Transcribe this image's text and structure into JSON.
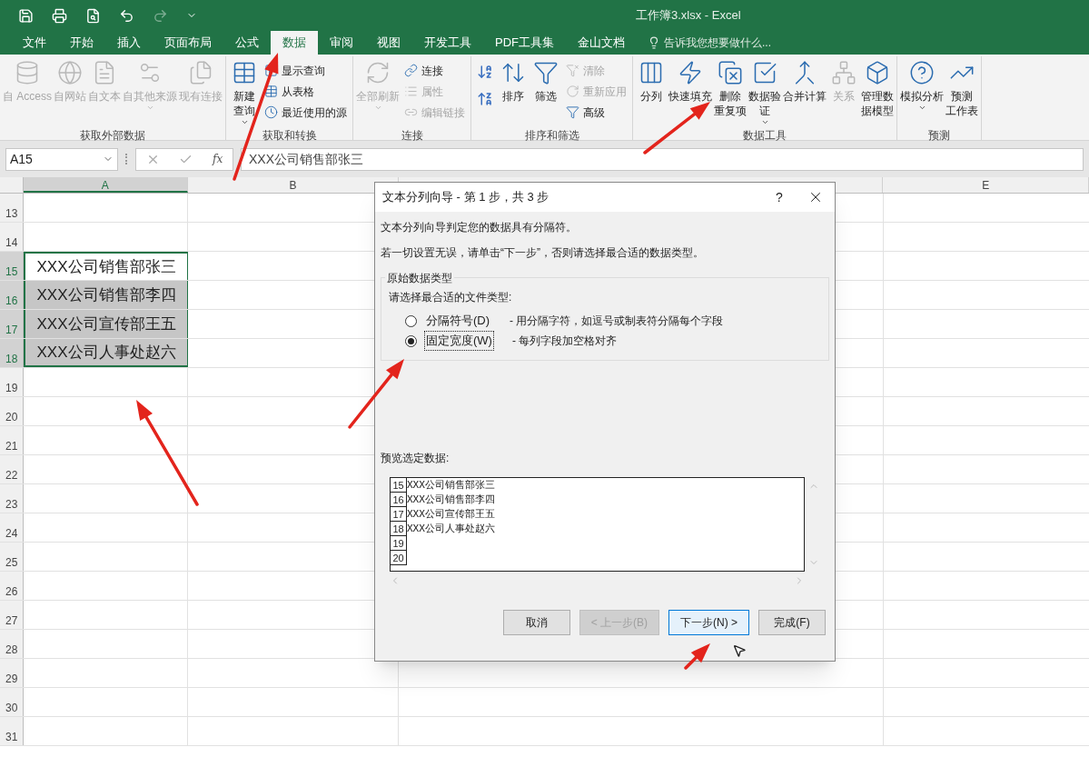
{
  "window": {
    "title": "工作簿3.xlsx - Excel"
  },
  "tabs": [
    {
      "label": "文件",
      "selected": false
    },
    {
      "label": "开始",
      "selected": false
    },
    {
      "label": "插入",
      "selected": false
    },
    {
      "label": "页面布局",
      "selected": false
    },
    {
      "label": "公式",
      "selected": false
    },
    {
      "label": "数据",
      "selected": true
    },
    {
      "label": "审阅",
      "selected": false
    },
    {
      "label": "视图",
      "selected": false
    },
    {
      "label": "开发工具",
      "selected": false
    },
    {
      "label": "PDF工具集",
      "selected": false
    },
    {
      "label": "金山文档",
      "selected": false
    }
  ],
  "tell_me": {
    "placeholder": "告诉我您想要做什么..."
  },
  "ribbon": [
    {
      "label": "获取外部数据",
      "items": [
        {
          "kind": "large",
          "lines": [
            "自 Access"
          ],
          "disabled": true
        },
        {
          "kind": "large",
          "lines": [
            "自网站"
          ],
          "disabled": true
        },
        {
          "kind": "large",
          "lines": [
            "自文本"
          ],
          "disabled": true
        },
        {
          "kind": "large",
          "lines": [
            "自其他来源"
          ],
          "disabled": true,
          "menu": true
        },
        {
          "kind": "large",
          "lines": [
            "现有连接"
          ],
          "disabled": true
        }
      ]
    },
    {
      "label": "获取和转换",
      "items": [
        {
          "kind": "large",
          "lines": [
            "新建",
            "查询"
          ],
          "disabled": false,
          "menu": true
        },
        {
          "kind": "small",
          "lines": [
            "显示查询"
          ],
          "disabled": false
        },
        {
          "kind": "small",
          "lines": [
            "从表格"
          ],
          "disabled": false
        },
        {
          "kind": "small",
          "lines": [
            "最近使用的源"
          ],
          "disabled": false
        }
      ]
    },
    {
      "label": "连接",
      "items": [
        {
          "kind": "large",
          "lines": [
            "全部刷新"
          ],
          "disabled": true,
          "menu": true
        },
        {
          "kind": "small",
          "lines": [
            "连接"
          ],
          "disabled": false
        },
        {
          "kind": "small",
          "lines": [
            "属性"
          ],
          "disabled": true
        },
        {
          "kind": "small",
          "lines": [
            "编辑链接"
          ],
          "disabled": true
        }
      ]
    },
    {
      "label": "排序和筛选",
      "items": [
        {
          "kind": "large",
          "lines": [
            "排序"
          ],
          "disabled": false
        },
        {
          "kind": "large",
          "lines": [
            "筛选"
          ],
          "disabled": false
        },
        {
          "kind": "small",
          "lines": [
            "清除"
          ],
          "disabled": true
        },
        {
          "kind": "small",
          "lines": [
            "重新应用"
          ],
          "disabled": true
        },
        {
          "kind": "small",
          "lines": [
            "高级"
          ],
          "disabled": false
        }
      ]
    },
    {
      "label": "数据工具",
      "items": [
        {
          "kind": "large",
          "lines": [
            "分列"
          ],
          "disabled": false
        },
        {
          "kind": "large",
          "lines": [
            "快速填充"
          ],
          "disabled": false
        },
        {
          "kind": "large",
          "lines": [
            "删除",
            "重复项"
          ],
          "disabled": false
        },
        {
          "kind": "large",
          "lines": [
            "数据验",
            "证"
          ],
          "disabled": false,
          "menu": true
        },
        {
          "kind": "large",
          "lines": [
            "合并计算"
          ],
          "disabled": false
        },
        {
          "kind": "large",
          "lines": [
            "关系"
          ],
          "disabled": true
        },
        {
          "kind": "large",
          "lines": [
            "管理数",
            "据模型"
          ],
          "disabled": false
        }
      ]
    },
    {
      "label": "预测",
      "items": [
        {
          "kind": "large",
          "lines": [
            "模拟分析"
          ],
          "disabled": false,
          "menu": true
        },
        {
          "kind": "large",
          "lines": [
            "预测",
            "工作表"
          ],
          "disabled": false
        }
      ]
    }
  ],
  "formula_bar": {
    "name_box": "A15",
    "fx_label": "fx",
    "value": "XXX公司销售部张三"
  },
  "columns": [
    {
      "label": "A",
      "selected": true
    },
    {
      "label": "B",
      "selected": false
    },
    {
      "label": "E",
      "selected": false
    }
  ],
  "rows": [
    {
      "number": "13",
      "selected": false
    },
    {
      "number": "14",
      "selected": false
    },
    {
      "number": "15",
      "value": "XXX公司销售部张三",
      "selected": true
    },
    {
      "number": "16",
      "value": "XXX公司销售部李四",
      "selected": true
    },
    {
      "number": "17",
      "value": "XXX公司宣传部王五",
      "selected": true
    },
    {
      "number": "18",
      "value": "XXX公司人事处赵六",
      "selected": true
    },
    {
      "number": "19",
      "selected": false
    },
    {
      "number": "20",
      "selected": false
    },
    {
      "number": "21",
      "selected": false
    },
    {
      "number": "22",
      "selected": false
    },
    {
      "number": "23",
      "selected": false
    },
    {
      "number": "24",
      "selected": false
    },
    {
      "number": "25",
      "selected": false
    },
    {
      "number": "26",
      "selected": false
    },
    {
      "number": "27",
      "selected": false
    },
    {
      "number": "28",
      "selected": false
    },
    {
      "number": "29",
      "selected": false
    },
    {
      "number": "30",
      "selected": false
    },
    {
      "number": "31",
      "selected": false
    }
  ],
  "dialog": {
    "title": "文本分列向导 - 第 1 步，共 3 步",
    "help": "?",
    "messages": [
      "文本分列向导判定您的数据具有分隔符。",
      "若一切设置无误，请单击“下一步”，否则请选择最合适的数据类型。"
    ],
    "group_label": "原始数据类型",
    "prompt": "请选择最合适的文件类型:",
    "options": [
      {
        "label": "分隔符号(D)",
        "description": "- 用分隔字符，如逗号或制表符分隔每个字段",
        "selected": false
      },
      {
        "label": "固定宽度(W)",
        "description": "- 每列字段加空格对齐",
        "selected": true
      }
    ],
    "preview_label": "预览选定数据:",
    "preview_rows": [
      {
        "number": "15",
        "text": "XXX公司销售部张三"
      },
      {
        "number": "16",
        "text": "XXX公司销售部李四"
      },
      {
        "number": "17",
        "text": "XXX公司宣传部王五"
      },
      {
        "number": "18",
        "text": "XXX公司人事处赵六"
      },
      {
        "number": "19"
      },
      {
        "number": "20"
      }
    ],
    "buttons": [
      {
        "label": "取消",
        "disabled": false,
        "default": false
      },
      {
        "label": "< 上一步(B)",
        "disabled": true,
        "default": false
      },
      {
        "label": "下一步(N) >",
        "disabled": false,
        "default": true
      },
      {
        "label": "完成(F)",
        "disabled": false,
        "default": false
      }
    ]
  }
}
